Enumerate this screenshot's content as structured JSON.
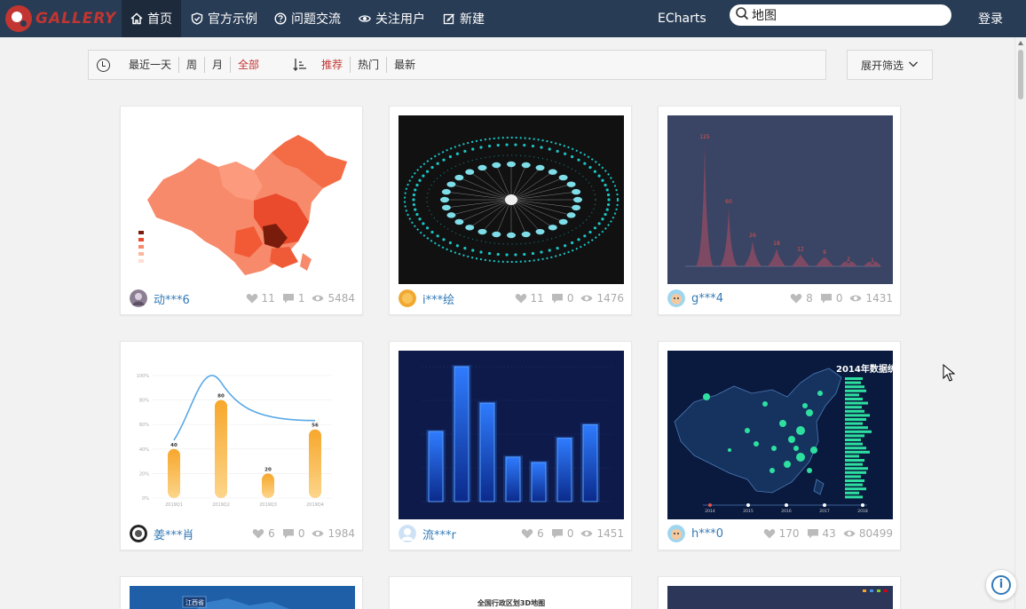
{
  "nav": {
    "logo_text": "GALLERY",
    "items": [
      {
        "label": "首页",
        "icon": "home-icon"
      },
      {
        "label": "官方示例",
        "icon": "shield-check-icon"
      },
      {
        "label": "问题交流",
        "icon": "question-circle-icon"
      },
      {
        "label": "关注用户",
        "icon": "eye-icon"
      },
      {
        "label": "新建",
        "icon": "edit-icon"
      }
    ],
    "echarts_label": "ECharts",
    "search_value": "地图",
    "login_label": "登录"
  },
  "filter": {
    "time_options": [
      "最近一天",
      "周",
      "月",
      "全部"
    ],
    "time_selected": "全部",
    "sort_options": [
      "推荐",
      "热门",
      "最新"
    ],
    "sort_selected": "推荐",
    "expand_label": "展开筛选"
  },
  "cards": [
    {
      "author": "动***6",
      "likes": "11",
      "comments": "1",
      "views": "5484",
      "thumb": "china-choropleth-map"
    },
    {
      "author": "i***绘",
      "likes": "11",
      "comments": "0",
      "views": "1476",
      "thumb": "radial-tree-graph"
    },
    {
      "author": "g***4",
      "likes": "8",
      "comments": "0",
      "views": "1431",
      "thumb": "spike-bar-chart"
    },
    {
      "author": "姜***肖",
      "likes": "6",
      "comments": "0",
      "views": "1984",
      "thumb": "bar-line-chart"
    },
    {
      "author": "流***r",
      "likes": "6",
      "comments": "0",
      "views": "1451",
      "thumb": "glow-bar-chart"
    },
    {
      "author": "h***0",
      "likes": "170",
      "comments": "43",
      "views": "80499",
      "thumb": "china-scatter-map"
    }
  ],
  "partial_cards": [
    {
      "thumb_text": "江西省"
    },
    {
      "thumb_text": "全国行政区划3D地图"
    },
    {
      "thumb_text": ""
    }
  ],
  "thumb_texts": {
    "spike_values": [
      "125",
      "60",
      "26",
      "18",
      "12",
      "9",
      "2",
      "1"
    ],
    "barline_values": [
      "40",
      "80",
      "20",
      "56"
    ],
    "barline_x": [
      "2019Q1",
      "2019Q2",
      "2019Q3",
      "2019Q4"
    ],
    "barline_y": [
      "100%",
      "80%",
      "60%",
      "40%",
      "20%",
      "0%"
    ],
    "scatter_title": "2014年数据统",
    "scatter_years": [
      "2014",
      "2015",
      "2016",
      "2017",
      "2018"
    ]
  },
  "colors": {
    "nav_bg": "#293c55",
    "brand_red": "#c23531",
    "link_blue": "#337ab7"
  }
}
